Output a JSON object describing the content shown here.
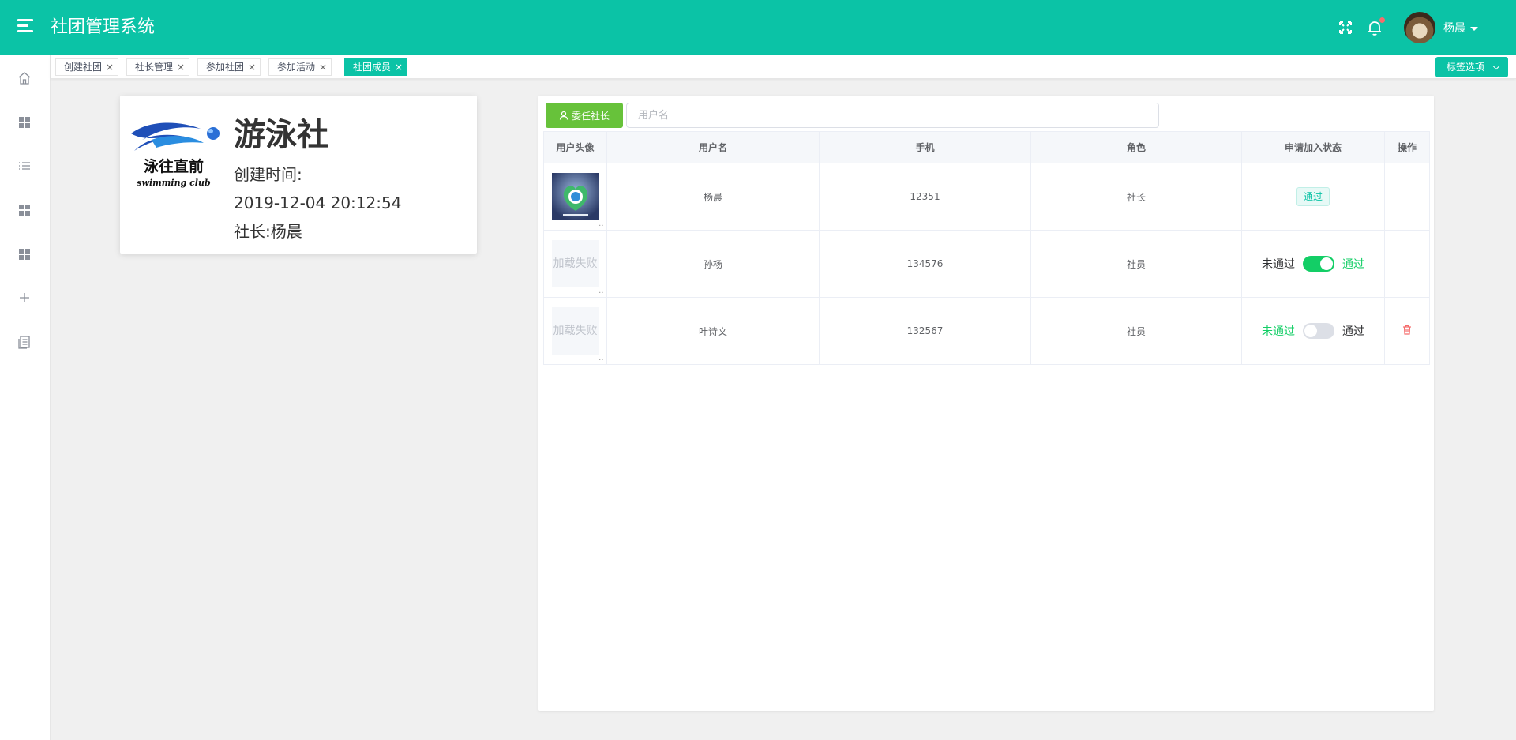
{
  "header": {
    "title": "社团管理系统",
    "user_name": "杨晨",
    "icons": [
      "menu-icon",
      "fullscreen-icon",
      "bell-icon",
      "caret-down-icon"
    ]
  },
  "sidebar": {
    "items": [
      {
        "icon": "home-icon"
      },
      {
        "icon": "grid-icon"
      },
      {
        "icon": "list-icon"
      },
      {
        "icon": "grid-icon"
      },
      {
        "icon": "grid-icon"
      },
      {
        "icon": "plus-icon"
      },
      {
        "icon": "document-icon"
      }
    ]
  },
  "tabs": {
    "items": [
      {
        "label": "创建社团",
        "close": "×"
      },
      {
        "label": "社长管理",
        "close": "×"
      },
      {
        "label": "参加社团",
        "close": "×"
      },
      {
        "label": "参加活动",
        "close": "×"
      },
      {
        "label": "社团成员",
        "close": "×",
        "active": true
      }
    ],
    "options_label": "标签选项"
  },
  "club": {
    "logo_text": "泳往直前",
    "logo_subtext": "swimming club",
    "name": "游泳社",
    "created_label": "创建时间:",
    "created_time": "2019-12-04 20:12:54",
    "leader": "社长:杨晨"
  },
  "members": {
    "appoint_button": "委任社长",
    "search_placeholder": "用户名",
    "columns": [
      "用户头像",
      "用户名",
      "手机",
      "角色",
      "申请加入状态",
      "操作"
    ],
    "avatar_fail_text": "加载失败",
    "ellipsis": "..",
    "rows": [
      {
        "username": "杨晨",
        "phone": "12351",
        "role": "社长",
        "status_tag": "通过"
      },
      {
        "username": "孙杨",
        "phone": "134576",
        "role": "社员",
        "switch_off_label": "未通过",
        "switch_on_label": "通过",
        "approved": true
      },
      {
        "username": "叶诗文",
        "phone": "132567",
        "role": "社员",
        "switch_off_label": "未通过",
        "switch_on_label": "通过",
        "approved": false
      }
    ]
  },
  "colors": {
    "primary": "#0bc3a6",
    "success": "#67c23a",
    "switch_on": "#13ce66",
    "danger": "#f56c6c"
  }
}
